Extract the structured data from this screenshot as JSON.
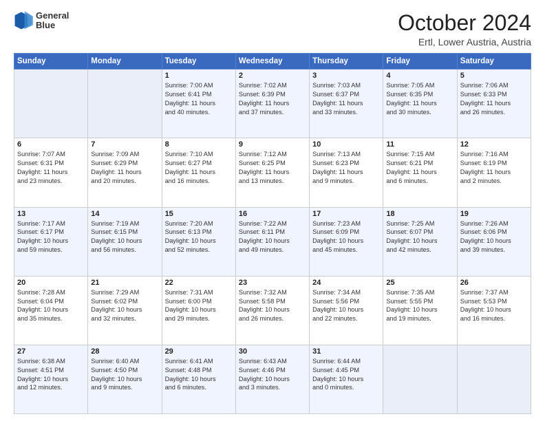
{
  "header": {
    "logo_line1": "General",
    "logo_line2": "Blue",
    "main_title": "October 2024",
    "subtitle": "Ertl, Lower Austria, Austria"
  },
  "days_of_week": [
    "Sunday",
    "Monday",
    "Tuesday",
    "Wednesday",
    "Thursday",
    "Friday",
    "Saturday"
  ],
  "weeks": [
    [
      {
        "day": "",
        "empty": true
      },
      {
        "day": "",
        "empty": true
      },
      {
        "day": "1",
        "lines": [
          "Sunrise: 7:00 AM",
          "Sunset: 6:41 PM",
          "Daylight: 11 hours",
          "and 40 minutes."
        ]
      },
      {
        "day": "2",
        "lines": [
          "Sunrise: 7:02 AM",
          "Sunset: 6:39 PM",
          "Daylight: 11 hours",
          "and 37 minutes."
        ]
      },
      {
        "day": "3",
        "lines": [
          "Sunrise: 7:03 AM",
          "Sunset: 6:37 PM",
          "Daylight: 11 hours",
          "and 33 minutes."
        ]
      },
      {
        "day": "4",
        "lines": [
          "Sunrise: 7:05 AM",
          "Sunset: 6:35 PM",
          "Daylight: 11 hours",
          "and 30 minutes."
        ]
      },
      {
        "day": "5",
        "lines": [
          "Sunrise: 7:06 AM",
          "Sunset: 6:33 PM",
          "Daylight: 11 hours",
          "and 26 minutes."
        ]
      }
    ],
    [
      {
        "day": "6",
        "lines": [
          "Sunrise: 7:07 AM",
          "Sunset: 6:31 PM",
          "Daylight: 11 hours",
          "and 23 minutes."
        ]
      },
      {
        "day": "7",
        "lines": [
          "Sunrise: 7:09 AM",
          "Sunset: 6:29 PM",
          "Daylight: 11 hours",
          "and 20 minutes."
        ]
      },
      {
        "day": "8",
        "lines": [
          "Sunrise: 7:10 AM",
          "Sunset: 6:27 PM",
          "Daylight: 11 hours",
          "and 16 minutes."
        ]
      },
      {
        "day": "9",
        "lines": [
          "Sunrise: 7:12 AM",
          "Sunset: 6:25 PM",
          "Daylight: 11 hours",
          "and 13 minutes."
        ]
      },
      {
        "day": "10",
        "lines": [
          "Sunrise: 7:13 AM",
          "Sunset: 6:23 PM",
          "Daylight: 11 hours",
          "and 9 minutes."
        ]
      },
      {
        "day": "11",
        "lines": [
          "Sunrise: 7:15 AM",
          "Sunset: 6:21 PM",
          "Daylight: 11 hours",
          "and 6 minutes."
        ]
      },
      {
        "day": "12",
        "lines": [
          "Sunrise: 7:16 AM",
          "Sunset: 6:19 PM",
          "Daylight: 11 hours",
          "and 2 minutes."
        ]
      }
    ],
    [
      {
        "day": "13",
        "lines": [
          "Sunrise: 7:17 AM",
          "Sunset: 6:17 PM",
          "Daylight: 10 hours",
          "and 59 minutes."
        ]
      },
      {
        "day": "14",
        "lines": [
          "Sunrise: 7:19 AM",
          "Sunset: 6:15 PM",
          "Daylight: 10 hours",
          "and 56 minutes."
        ]
      },
      {
        "day": "15",
        "lines": [
          "Sunrise: 7:20 AM",
          "Sunset: 6:13 PM",
          "Daylight: 10 hours",
          "and 52 minutes."
        ]
      },
      {
        "day": "16",
        "lines": [
          "Sunrise: 7:22 AM",
          "Sunset: 6:11 PM",
          "Daylight: 10 hours",
          "and 49 minutes."
        ]
      },
      {
        "day": "17",
        "lines": [
          "Sunrise: 7:23 AM",
          "Sunset: 6:09 PM",
          "Daylight: 10 hours",
          "and 45 minutes."
        ]
      },
      {
        "day": "18",
        "lines": [
          "Sunrise: 7:25 AM",
          "Sunset: 6:07 PM",
          "Daylight: 10 hours",
          "and 42 minutes."
        ]
      },
      {
        "day": "19",
        "lines": [
          "Sunrise: 7:26 AM",
          "Sunset: 6:06 PM",
          "Daylight: 10 hours",
          "and 39 minutes."
        ]
      }
    ],
    [
      {
        "day": "20",
        "lines": [
          "Sunrise: 7:28 AM",
          "Sunset: 6:04 PM",
          "Daylight: 10 hours",
          "and 35 minutes."
        ]
      },
      {
        "day": "21",
        "lines": [
          "Sunrise: 7:29 AM",
          "Sunset: 6:02 PM",
          "Daylight: 10 hours",
          "and 32 minutes."
        ]
      },
      {
        "day": "22",
        "lines": [
          "Sunrise: 7:31 AM",
          "Sunset: 6:00 PM",
          "Daylight: 10 hours",
          "and 29 minutes."
        ]
      },
      {
        "day": "23",
        "lines": [
          "Sunrise: 7:32 AM",
          "Sunset: 5:58 PM",
          "Daylight: 10 hours",
          "and 26 minutes."
        ]
      },
      {
        "day": "24",
        "lines": [
          "Sunrise: 7:34 AM",
          "Sunset: 5:56 PM",
          "Daylight: 10 hours",
          "and 22 minutes."
        ]
      },
      {
        "day": "25",
        "lines": [
          "Sunrise: 7:35 AM",
          "Sunset: 5:55 PM",
          "Daylight: 10 hours",
          "and 19 minutes."
        ]
      },
      {
        "day": "26",
        "lines": [
          "Sunrise: 7:37 AM",
          "Sunset: 5:53 PM",
          "Daylight: 10 hours",
          "and 16 minutes."
        ]
      }
    ],
    [
      {
        "day": "27",
        "lines": [
          "Sunrise: 6:38 AM",
          "Sunset: 4:51 PM",
          "Daylight: 10 hours",
          "and 12 minutes."
        ]
      },
      {
        "day": "28",
        "lines": [
          "Sunrise: 6:40 AM",
          "Sunset: 4:50 PM",
          "Daylight: 10 hours",
          "and 9 minutes."
        ]
      },
      {
        "day": "29",
        "lines": [
          "Sunrise: 6:41 AM",
          "Sunset: 4:48 PM",
          "Daylight: 10 hours",
          "and 6 minutes."
        ]
      },
      {
        "day": "30",
        "lines": [
          "Sunrise: 6:43 AM",
          "Sunset: 4:46 PM",
          "Daylight: 10 hours",
          "and 3 minutes."
        ]
      },
      {
        "day": "31",
        "lines": [
          "Sunrise: 6:44 AM",
          "Sunset: 4:45 PM",
          "Daylight: 10 hours",
          "and 0 minutes."
        ]
      },
      {
        "day": "",
        "empty": true
      },
      {
        "day": "",
        "empty": true
      }
    ]
  ]
}
